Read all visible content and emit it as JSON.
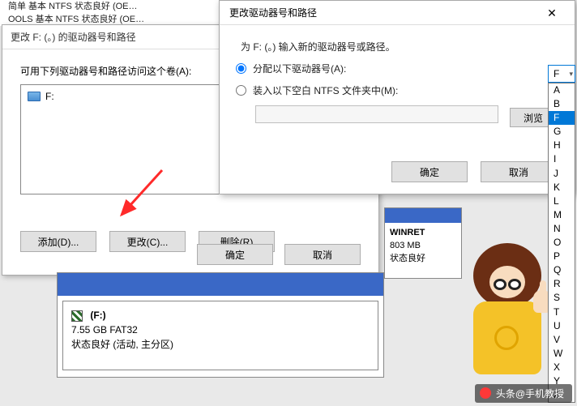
{
  "bg_table": {
    "l1": "简单  基本  NTFS   状态良好 (OE…",
    "l2": "OOLS  基本  NTFS   状态良好 (OE…"
  },
  "dialog1": {
    "title": "更改 F: (。) 的驱动器号和路径",
    "hint": "可用下列驱动器号和路径访问这个卷(A):",
    "drive_entry": "F:",
    "btn_add": "添加(D)...",
    "btn_change": "更改(C)...",
    "btn_remove": "删除(R)",
    "btn_ok": "确定",
    "btn_cancel": "取消"
  },
  "dialog2": {
    "title": "更改驱动器号和路径",
    "instruction": "为 F: (。) 输入新的驱动器号或路径。",
    "opt_assign": "分配以下驱动器号(A):",
    "opt_mount": "装入以下空白 NTFS 文件夹中(M):",
    "btn_browse": "浏览",
    "btn_ok": "确定",
    "btn_cancel": "取消"
  },
  "drive_combo": {
    "value": "F",
    "options": [
      "A",
      "B",
      "F",
      "G",
      "H",
      "I",
      "J",
      "K",
      "L",
      "M",
      "N",
      "O",
      "P",
      "Q",
      "R",
      "S",
      "T",
      "U",
      "V",
      "W",
      "X",
      "Y",
      "Z"
    ],
    "selected": "F"
  },
  "small_box": {
    "name": "WINRET",
    "size": "803 MB",
    "status": "状态良好"
  },
  "disk_panel": {
    "label": "(F:)",
    "info": "7.55 GB FAT32",
    "status": "状态良好 (活动, 主分区)"
  },
  "watermark": "头条@手机教授"
}
